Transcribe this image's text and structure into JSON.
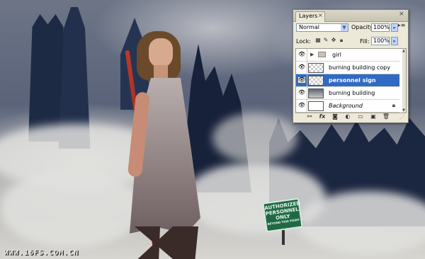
{
  "canvas": {
    "sign": {
      "line1": "AUTHORIZED",
      "line2": "PERSONNEL",
      "line3": "ONLY",
      "line4": "BEYOND THIS POINT"
    },
    "watermark": "WWW.16FS.COM.CN"
  },
  "layers_panel": {
    "tab_label": "Layers",
    "tab_close_glyph": "×",
    "panel_close_glyph": "×",
    "menu_glyph": "▸≡",
    "blend_mode": "Normal",
    "opacity_label": "Opacity:",
    "opacity_value": "100%",
    "lock_label": "Lock:",
    "fill_label": "Fill:",
    "fill_value": "100%",
    "layers": [
      {
        "name": "girl",
        "type": "group"
      },
      {
        "name": "burning building copy",
        "type": "layer"
      },
      {
        "name": "personnel sign",
        "type": "layer",
        "selected": true
      },
      {
        "name": "burning building",
        "type": "layer"
      },
      {
        "name": "Background",
        "type": "background"
      }
    ],
    "bottom_icons": [
      "link-icon",
      "fx-icon",
      "mask-icon",
      "adjustment-icon",
      "group-folder-icon",
      "new-layer-icon",
      "trash-icon"
    ]
  },
  "colors": {
    "selection": "#316ac5",
    "panel_bg": "#ece9d8",
    "sign_green": "#1f6a45"
  }
}
